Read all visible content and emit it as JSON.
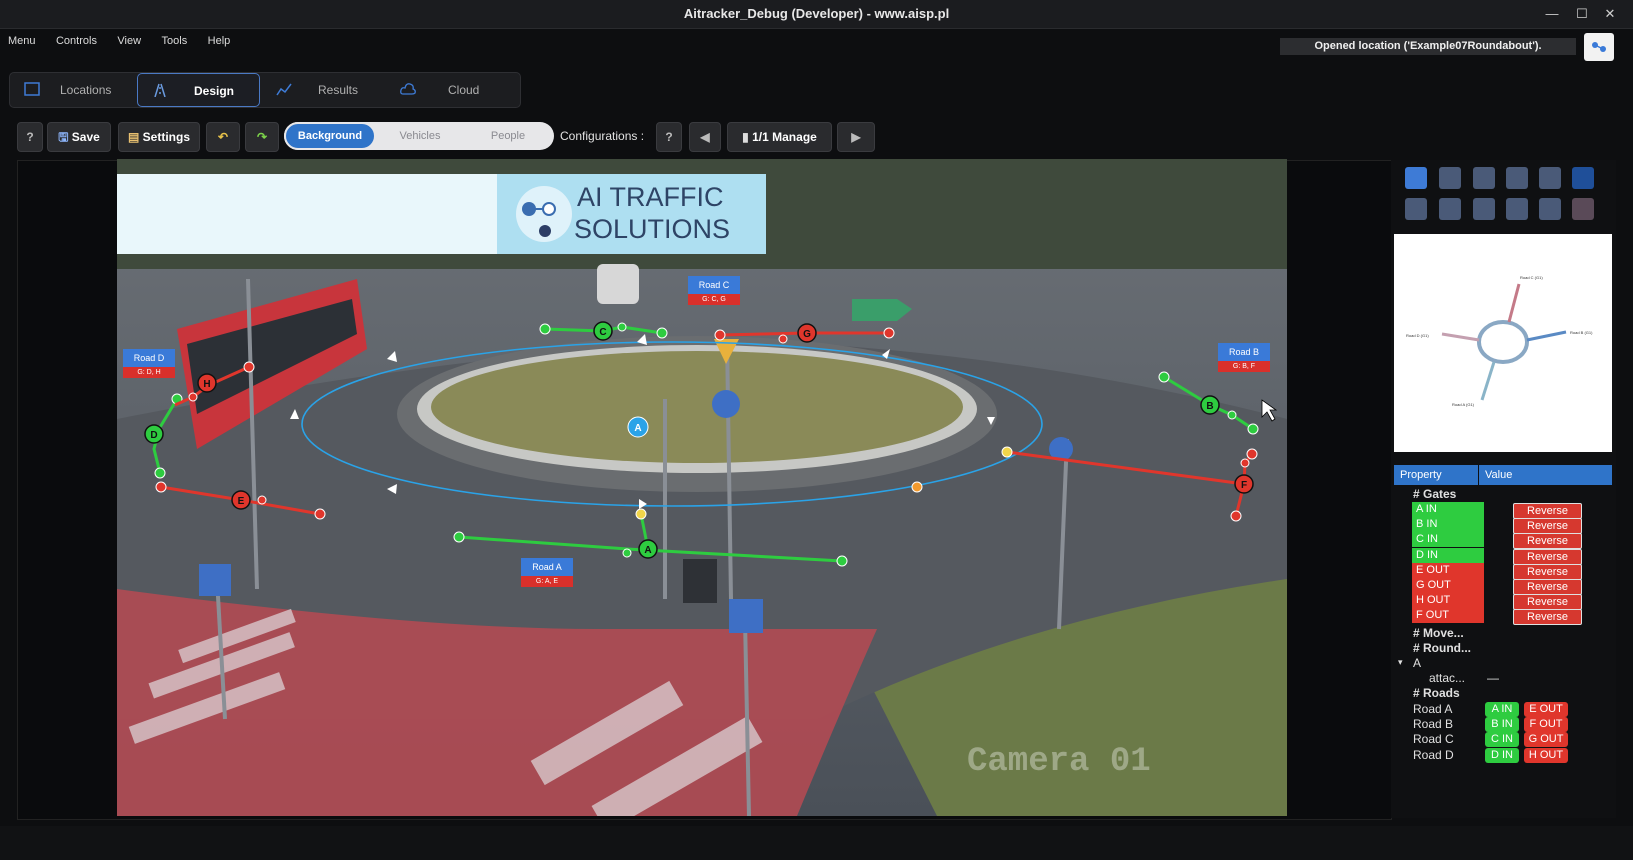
{
  "window": {
    "title": "Aitracker_Debug (Developer) - www.aisp.pl"
  },
  "menu": [
    "Menu",
    "Controls",
    "View",
    "Tools",
    "Help"
  ],
  "status": "Opened location ('Example07Roundabout').",
  "tabs": [
    {
      "label": "Locations",
      "icon": "map-icon"
    },
    {
      "label": "Design",
      "icon": "road-icon"
    },
    {
      "label": "Results",
      "icon": "chart-icon"
    },
    {
      "label": "Cloud",
      "icon": "cloud-icon"
    }
  ],
  "toolbar": {
    "help": "?",
    "save": "Save",
    "settings": "Settings",
    "modes": [
      "Background",
      "Vehicles",
      "People"
    ],
    "configurations_label": "Configurations :",
    "cfg_help": "?",
    "manage": "1/1 Manage"
  },
  "banner": {
    "line1": "AI TRAFFIC",
    "line2": "SOLUTIONS"
  },
  "overlay": {
    "road_tags": [
      {
        "name": "Road A",
        "gates": "G: A, E"
      },
      {
        "name": "Road B",
        "gates": "G: B, F"
      },
      {
        "name": "Road C",
        "gates": "G: C, G"
      },
      {
        "name": "Road D",
        "gates": "G: D, H"
      }
    ],
    "gate_letters": [
      "A",
      "B",
      "C",
      "D",
      "E",
      "F",
      "G",
      "H"
    ],
    "roundabout_label": "A",
    "camera_text": "Camera 01"
  },
  "minimap": {
    "labels": [
      "Road C (G1)",
      "Road B (G1)",
      "Road D (G1)",
      "Road A (G1)"
    ]
  },
  "properties": {
    "header": {
      "property": "Property",
      "value": "Value"
    },
    "gates_section": "# Gates",
    "gates": [
      {
        "name": "A IN",
        "type": "in"
      },
      {
        "name": "B IN",
        "type": "in"
      },
      {
        "name": "C IN",
        "type": "in"
      },
      {
        "name": "D IN",
        "type": "in"
      },
      {
        "name": "E OUT",
        "type": "out"
      },
      {
        "name": "G OUT",
        "type": "out"
      },
      {
        "name": "H OUT",
        "type": "out"
      },
      {
        "name": "F OUT",
        "type": "out"
      }
    ],
    "reverse_label": "Reverse",
    "move_section": "# Move...",
    "round_section": "# Round...",
    "round_item": "A",
    "attach_label": "attac...",
    "attach_value": "—",
    "roads_section": "# Roads",
    "roads": [
      {
        "name": "Road A",
        "in": "A IN",
        "out": "E OUT"
      },
      {
        "name": "Road B",
        "in": "B IN",
        "out": "F OUT"
      },
      {
        "name": "Road C",
        "in": "C IN",
        "out": "G OUT"
      },
      {
        "name": "Road D",
        "in": "D IN",
        "out": "H OUT"
      }
    ]
  },
  "colors": {
    "accent": "#2f74c9",
    "gate_in": "#2ecc40",
    "gate_out": "#e0362c",
    "roundabout": "#2aa3e8"
  }
}
